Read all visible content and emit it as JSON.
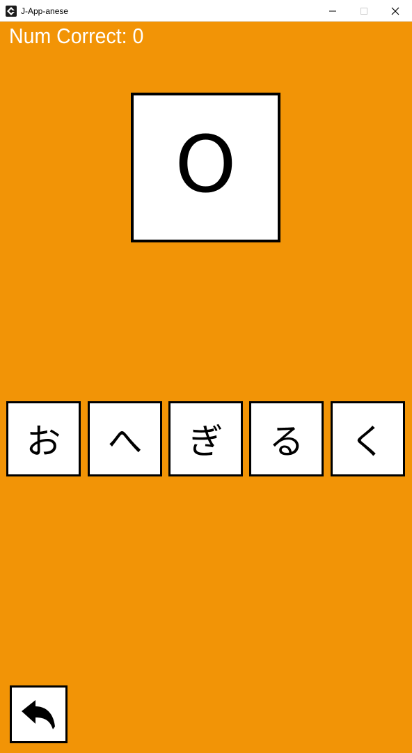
{
  "window": {
    "title": "J-App-anese",
    "controls": [
      "minimize-icon",
      "maximize-icon",
      "close-icon"
    ]
  },
  "score": {
    "label": "Num Correct: 0"
  },
  "prompt": {
    "romaji": "O"
  },
  "choices": [
    {
      "kana": "お"
    },
    {
      "kana": "へ"
    },
    {
      "kana": "ぎ"
    },
    {
      "kana": "る"
    },
    {
      "kana": "く"
    }
  ],
  "back_button": {
    "icon": "back-arrow-icon"
  },
  "colors": {
    "background": "#f29406",
    "card": "#ffffff",
    "border": "#000000",
    "score_text": "#ffffff"
  }
}
